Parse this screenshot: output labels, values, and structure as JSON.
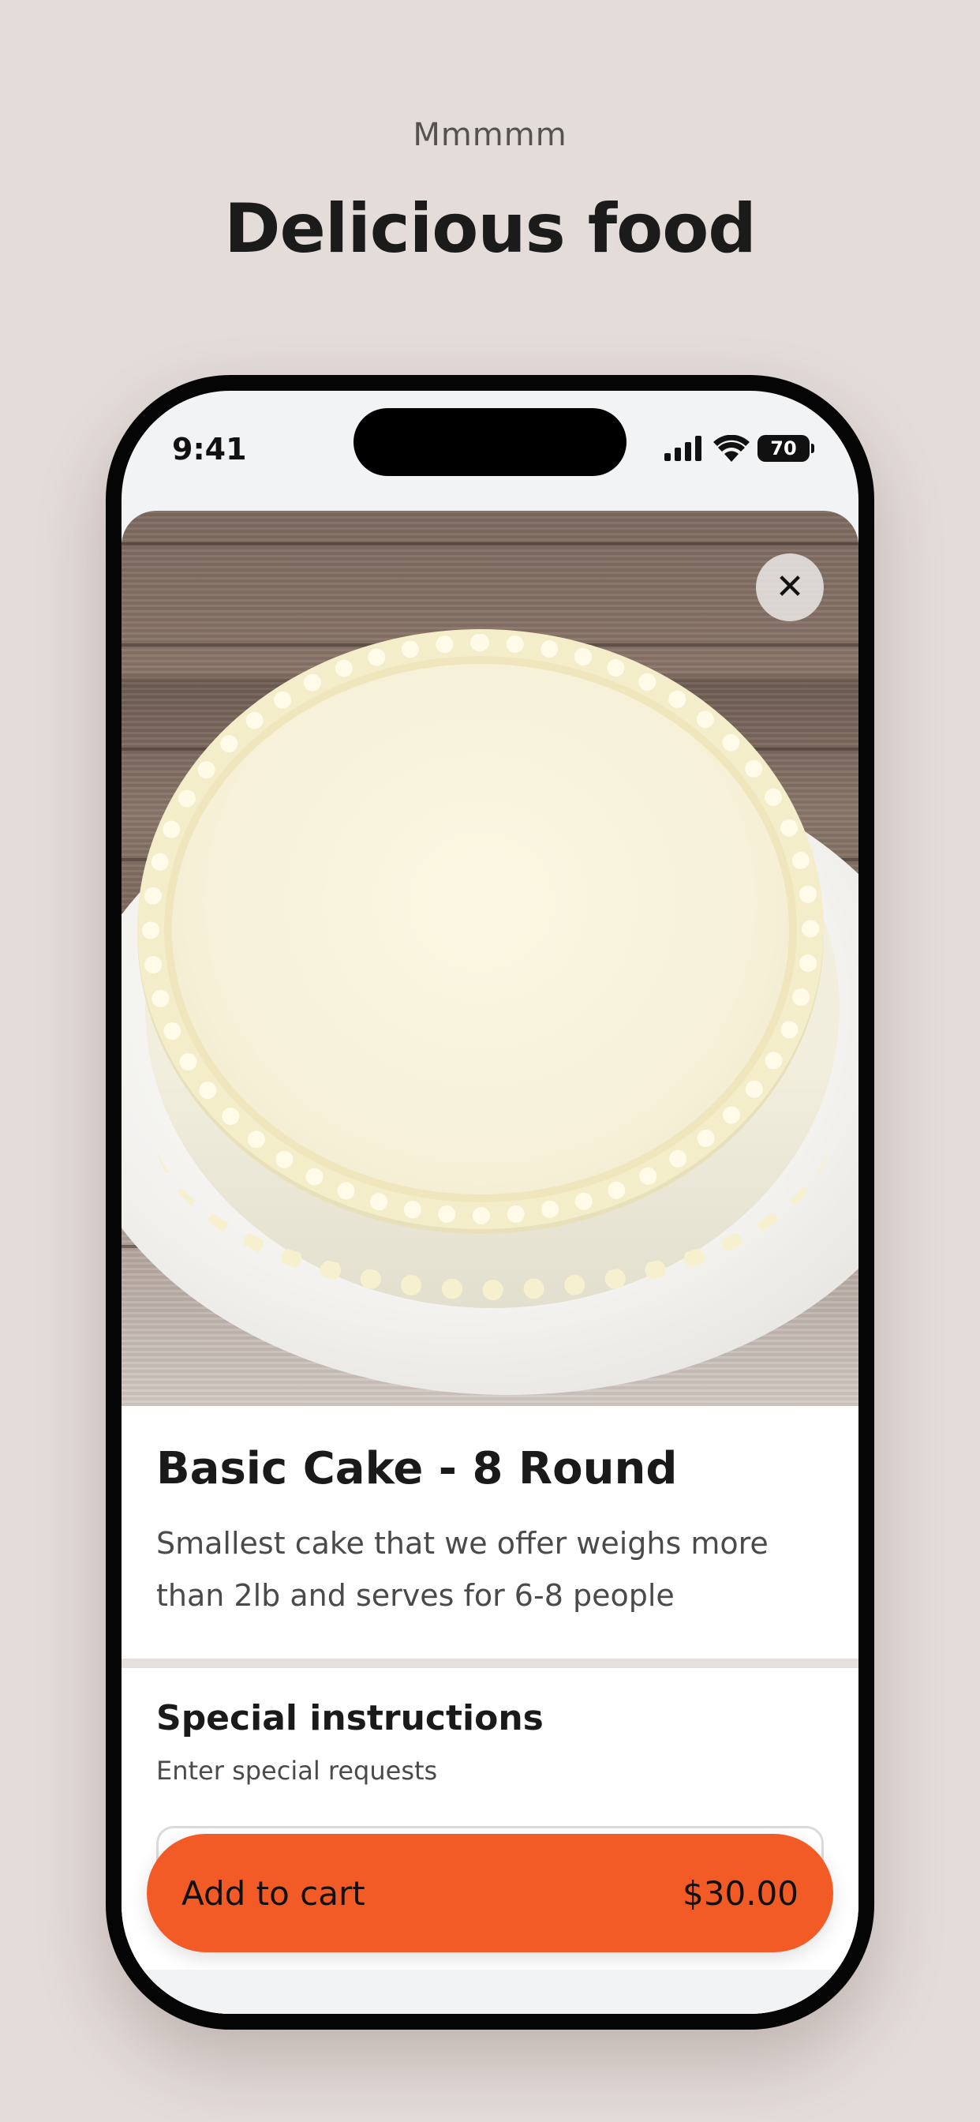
{
  "promo": {
    "subtitle": "Mmmmm",
    "title": "Delicious food"
  },
  "status_bar": {
    "time": "9:41",
    "battery": "70",
    "icons": [
      "signal-icon",
      "wifi-icon",
      "battery-icon"
    ]
  },
  "product": {
    "image_alt": "Basic cake",
    "title": "Basic Cake - 8 Round",
    "description": "Smallest cake that we offer weighs more than 2lb and serves for 6-8 people"
  },
  "instructions": {
    "title": "Special instructions",
    "subtitle": "Enter special requests",
    "value": ""
  },
  "cart": {
    "label": "Add to cart",
    "price": "$30.00"
  },
  "colors": {
    "background": "#e4dcd9",
    "accent": "#f25b25",
    "text": "#1a1a1a"
  }
}
